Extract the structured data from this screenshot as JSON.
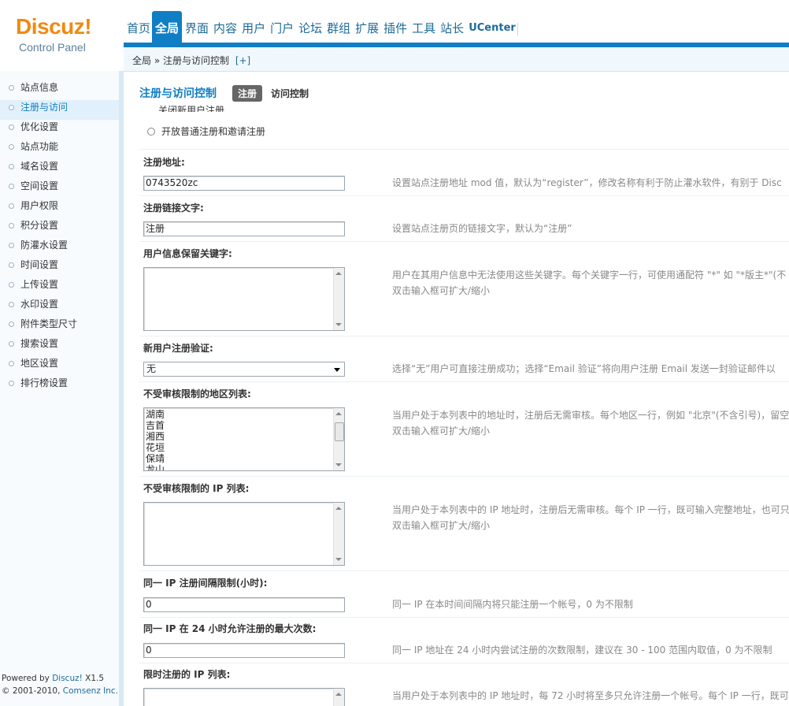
{
  "header": {
    "brand": "Discuz!",
    "subtitle": "Control Panel",
    "nav": [
      "首页",
      "全局",
      "界面",
      "内容",
      "用户",
      "门户",
      "论坛",
      "群组",
      "扩展",
      "插件",
      "工具",
      "站长",
      "UCenter"
    ],
    "active_nav": "全局"
  },
  "breadcrumb": {
    "path": "全局 » 注册与访问控制",
    "add": "[+]"
  },
  "sidebar": {
    "items": [
      "站点信息",
      "注册与访问",
      "优化设置",
      "站点功能",
      "域名设置",
      "空间设置",
      "用户权限",
      "积分设置",
      "防灌水设置",
      "时间设置",
      "上传设置",
      "水印设置",
      "附件类型尺寸",
      "搜索设置",
      "地区设置",
      "排行榜设置"
    ],
    "active": "注册与访问",
    "footer_powered": "Powered by ",
    "footer_product": "Discuz!",
    "footer_version": " X1.5",
    "footer_copy": "© 2001-2010, ",
    "footer_company": "Comsenz Inc."
  },
  "main": {
    "title": "注册与访问控制",
    "tabs": [
      "注册",
      "访问控制"
    ],
    "active_tab": "注册",
    "clipped_option": "关闭新用户注册",
    "radio_option": "开放普通注册和邀请注册",
    "rows": [
      {
        "label": "注册地址:",
        "value": "0743520zc",
        "tip": "设置站点注册地址 mod 值，默认为“register”，修改名称有利于防止灌水软件，有别于 Disc"
      },
      {
        "label": "注册链接文字:",
        "value": "注册",
        "tip": "设置站点注册页的链接文字，默认为“注册”"
      },
      {
        "label": "用户信息保留关键字:",
        "tip": "用户在其用户信息中无法使用这些关键字。每个关键字一行，可使用通配符 \"*\" 如 \"*版主*\"(不",
        "tip2": "双击输入框可扩大/缩小"
      },
      {
        "label": "新用户注册验证:",
        "value": "无",
        "tip": "选择“无”用户可直接注册成功；选择“Email 验证”将向用户注册 Email 发送一封验证邮件以"
      },
      {
        "label": "不受审核限制的地区列表:",
        "lines": [
          "湖南",
          "吉首",
          "湘西",
          "花垣",
          "保靖",
          "龙山"
        ],
        "tip": "当用户处于本列表中的地址时，注册后无需审核。每个地区一行，例如 \"北京\"(不含引号)，留空",
        "tip2": "双击输入框可扩大/缩小"
      },
      {
        "label": "不受审核限制的 IP 列表:",
        "tip": "当用户处于本列表中的 IP 地址时，注册后无需审核。每个 IP 一行，既可输入完整地址，也可只",
        "tip2": "双击输入框可扩大/缩小"
      },
      {
        "label": "同一 IP 注册间隔限制(小时):",
        "value": "0",
        "tip": "同一 IP 在本时间间隔内将只能注册一个帐号，0 为不限制"
      },
      {
        "label": "同一 IP 在 24 小时允许注册的最大次数:",
        "value": "0",
        "tip": "同一 IP 地址在 24 小时内尝试注册的次数限制，建议在 30 - 100 范围内取值，0 为不限制"
      },
      {
        "label": "限时注册的 IP 列表:",
        "tip": "当用户处于本列表中的 IP 地址时，每 72 小时将至多只允许注册一个帐号。每个 IP 一行，既可"
      }
    ]
  }
}
